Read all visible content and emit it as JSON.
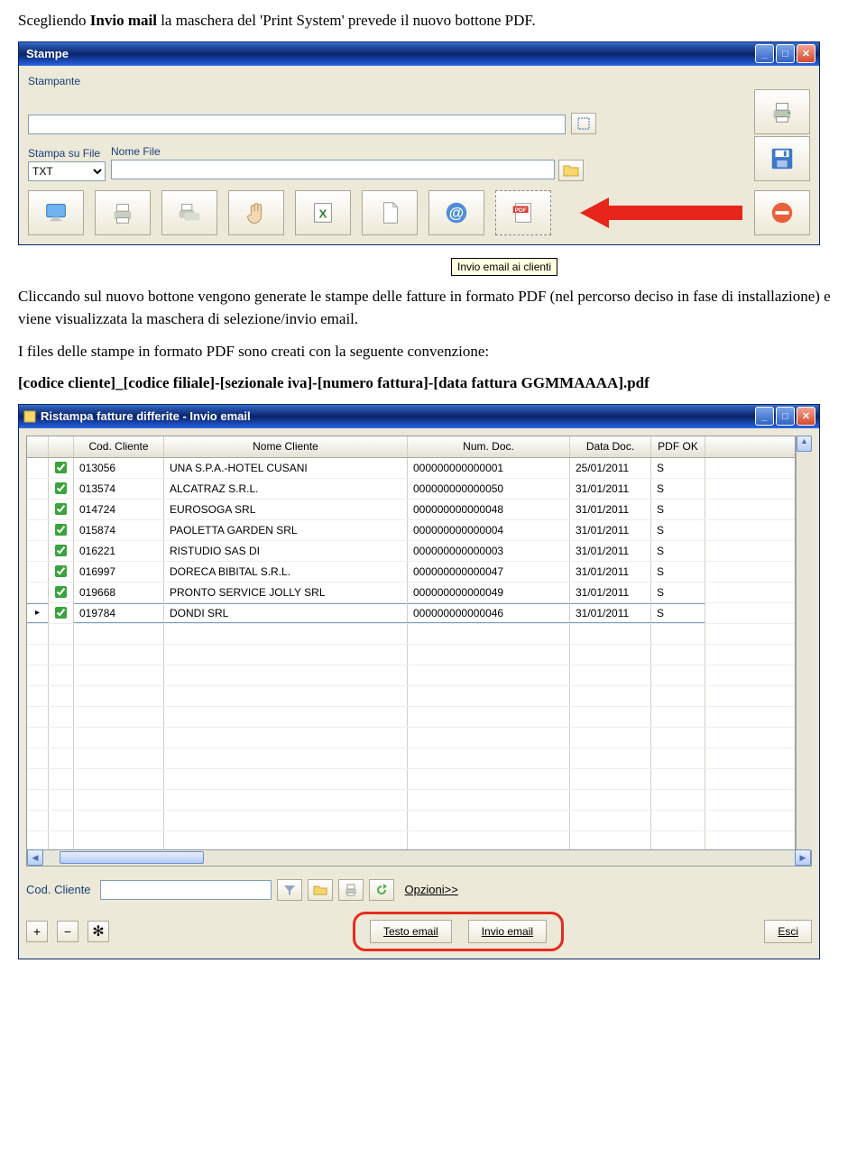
{
  "doc": {
    "p1_pre": "Scegliendo ",
    "p1_bold": "Invio mail",
    "p1_post": " la maschera del 'Print System' prevede il nuovo bottone PDF.",
    "p2": "Cliccando sul nuovo bottone vengono generate le stampe delle fatture in formato PDF (nel percorso deciso in fase di installazione) e viene visualizzata la maschera di selezione/invio email.",
    "p3": "I files delle stampe in formato PDF sono creati con la seguente convenzione:",
    "p4": "[codice cliente]_[codice filiale]-[sezionale iva]-[numero fattura]-[data fattura GGMMAAAA].pdf"
  },
  "stampe": {
    "title": "Stampe",
    "labels": {
      "stampante": "Stampante",
      "stampa_su_file": "Stampa su File",
      "nome_file": "Nome File"
    },
    "stampante_value": "",
    "stampa_su_file_value": "TXT",
    "nome_file_value": "",
    "tooltip": "Invio email ai clienti",
    "icons": {
      "screen": "monitor-icon",
      "printer": "printer-icon",
      "printer2": "multi-printer-icon",
      "hand": "hand-icon",
      "excel": "excel-icon",
      "doc": "document-icon",
      "mail": "at-sign-icon",
      "pdf": "pdf-icon",
      "cancel": "cancel-icon",
      "select": "select-icon",
      "folder": "folder-icon",
      "print_big": "print-big-icon",
      "save_big": "save-big-icon"
    }
  },
  "ristampa": {
    "title": "Ristampa fatture differite - Invio email",
    "headers": {
      "chk": "",
      "cod": "Cod. Cliente",
      "nome": "Nome Cliente",
      "num": "Num. Doc.",
      "data": "Data Doc.",
      "pdf": "PDF OK"
    },
    "rows": [
      {
        "chk": true,
        "cod": "013056",
        "nome": "UNA S.P.A.-HOTEL CUSANI",
        "num": "000000000000001",
        "data": "25/01/2011",
        "pdf": "S"
      },
      {
        "chk": true,
        "cod": "013574",
        "nome": "ALCATRAZ S.R.L.",
        "num": "000000000000050",
        "data": "31/01/2011",
        "pdf": "S"
      },
      {
        "chk": true,
        "cod": "014724",
        "nome": "EUROSOGA SRL",
        "num": "000000000000048",
        "data": "31/01/2011",
        "pdf": "S"
      },
      {
        "chk": true,
        "cod": "015874",
        "nome": "PAOLETTA GARDEN SRL",
        "num": "000000000000004",
        "data": "31/01/2011",
        "pdf": "S"
      },
      {
        "chk": true,
        "cod": "016221",
        "nome": "RISTUDIO SAS DI",
        "num": "000000000000003",
        "data": "31/01/2011",
        "pdf": "S"
      },
      {
        "chk": true,
        "cod": "016997",
        "nome": "DORECA BIBITAL S.R.L.",
        "num": "000000000000047",
        "data": "31/01/2011",
        "pdf": "S"
      },
      {
        "chk": true,
        "cod": "019668",
        "nome": "PRONTO SERVICE JOLLY SRL",
        "num": "000000000000049",
        "data": "31/01/2011",
        "pdf": "S"
      },
      {
        "chk": true,
        "cod": "019784",
        "nome": "DONDI SRL",
        "num": "000000000000046",
        "data": "31/01/2011",
        "pdf": "S",
        "cursor": true
      }
    ],
    "bottom": {
      "cod_cliente_label": "Cod. Cliente",
      "cod_cliente_value": "",
      "opzioni": "Opzioni>>",
      "testo_email": "Testo email",
      "invio_email": "Invio email",
      "esci": "Esci"
    }
  }
}
